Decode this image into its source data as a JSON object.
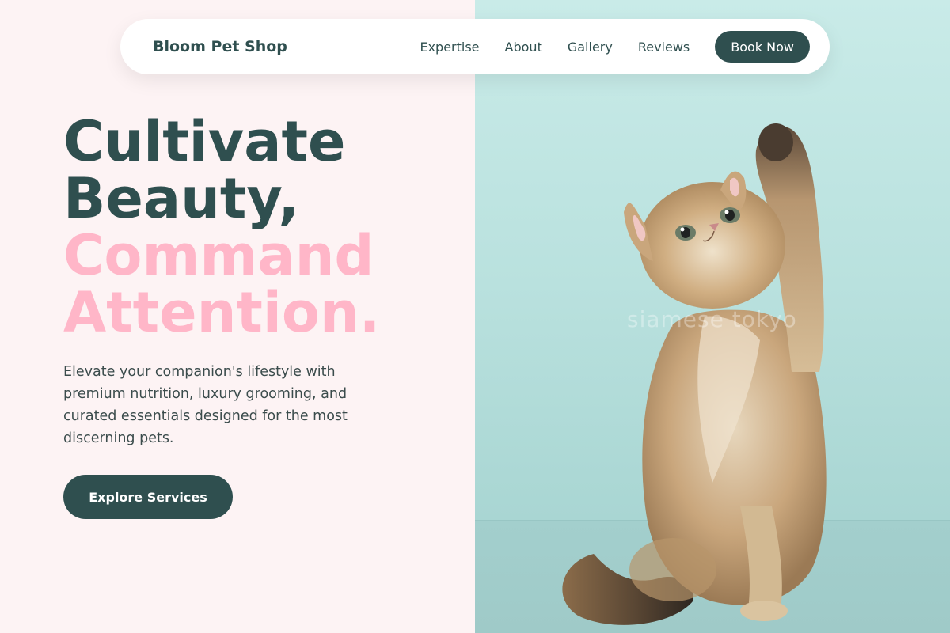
{
  "nav": {
    "brand": "Bloom Pet Shop",
    "links": [
      "Expertise",
      "About",
      "Gallery",
      "Reviews"
    ],
    "cta": "Book Now"
  },
  "hero": {
    "line1": "Cultivate",
    "line2": "Beauty,",
    "line3": "Command",
    "line4": "Attention.",
    "subtitle": "Elevate your companion's lifestyle with premium nutrition, luxury grooming, and curated essentials designed for the most discerning pets.",
    "cta": "Explore Services"
  },
  "image": {
    "subject": "kitten-raising-paw",
    "watermark": "siamese tokyo"
  },
  "colors": {
    "primary": "#2f4f4f",
    "accent_pink": "#ffb6c8",
    "left_background": "#fdf3f4",
    "right_background": "#bfe4e1"
  }
}
